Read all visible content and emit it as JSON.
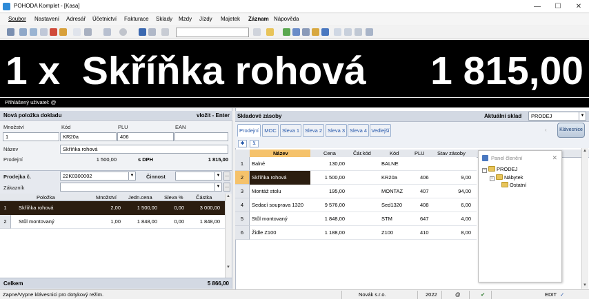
{
  "window": {
    "title": "POHODA Komplet - [Kasa]",
    "controls": {
      "minimize": "—",
      "maximize": "☐",
      "close": "✕"
    }
  },
  "menu": [
    {
      "label": "Soubor"
    },
    {
      "label": "Nastavení"
    },
    {
      "label": "Adresář"
    },
    {
      "label": "Účetnictví"
    },
    {
      "label": "Fakturace"
    },
    {
      "label": "Sklady"
    },
    {
      "label": "Mzdy"
    },
    {
      "label": "Jízdy"
    },
    {
      "label": "Majetek"
    },
    {
      "label": "Záznam"
    },
    {
      "label": "Nápověda"
    }
  ],
  "display": {
    "item": "1 x  Skříňka rohová",
    "amount": "1 815,00"
  },
  "user_bar": {
    "label": "Přihlášený uživatel: @"
  },
  "new_item": {
    "header": "Nová položka dokladu",
    "hint": "vložit - Enter",
    "labels": {
      "quantity": "Množství",
      "code": "Kód",
      "plu": "PLU",
      "ean": "EAN",
      "name": "Název",
      "price": "Prodejní",
      "vat": "s DPH"
    },
    "values": {
      "quantity": "1",
      "code": "KR20a",
      "plu": "406",
      "ean": "",
      "name": "Skříňka rohová",
      "price": "1 500,00",
      "total": "1 815,00"
    }
  },
  "receipt": {
    "label": "Prodejka č.",
    "number": "22K0300002",
    "activity_label": "Činnost",
    "customer_label": "Zákazník",
    "dots": "...",
    "columns": [
      "Položka",
      "Množství",
      "Jedn.cena",
      "Sleva %",
      "Částka"
    ],
    "rows": [
      {
        "num": "1",
        "item": "Skříňka rohová",
        "qty": "2,00",
        "unit": "1 500,00",
        "disc": "0,00",
        "amount": "3 000,00"
      },
      {
        "num": "2",
        "item": "Stůl montovaný",
        "qty": "1,00",
        "unit": "1 848,00",
        "disc": "0,00",
        "amount": "1 848,00"
      }
    ],
    "total_label": "Celkem",
    "total_value": "5 866,00"
  },
  "stock": {
    "header": "Skladové zásoby",
    "warehouse_label": "Aktuální sklad",
    "warehouse_value": "PRODEJ",
    "keyboard_button": "Klávesnice",
    "tabs": [
      "Prodejní",
      "MOC",
      "Sleva 1",
      "Sleva 2",
      "Sleva 3",
      "Sleva 4",
      "Vedlejší"
    ],
    "columns": [
      "Název",
      "Cena",
      "Čár.kód",
      "Kód",
      "PLU",
      "Stav zásoby"
    ],
    "rows": [
      {
        "num": "1",
        "name": "Balné",
        "price": "130,00",
        "barcode": "",
        "code": "BALNE",
        "plu": "",
        "stock": ""
      },
      {
        "num": "2",
        "name": "Skříňka rohová",
        "price": "1 500,00",
        "barcode": "",
        "code": "KR20a",
        "plu": "406",
        "stock": "9,00"
      },
      {
        "num": "3",
        "name": "Montáž stolu",
        "price": "195,00",
        "barcode": "",
        "code": "MONTAZ",
        "plu": "407",
        "stock": "94,00"
      },
      {
        "num": "4",
        "name": "Sedací souprava 1320",
        "price": "9 576,00",
        "barcode": "",
        "code": "Sed1320",
        "plu": "408",
        "stock": "6,00"
      },
      {
        "num": "5",
        "name": "Stůl montovaný",
        "price": "1 848,00",
        "barcode": "",
        "code": "STM",
        "plu": "647",
        "stock": "4,00"
      },
      {
        "num": "6",
        "name": "Židle Z100",
        "price": "1 188,00",
        "barcode": "",
        "code": "Z100",
        "plu": "410",
        "stock": "8,00"
      }
    ]
  },
  "tree_panel": {
    "title": "Panel členění",
    "close": "✕",
    "root": "PRODEJ",
    "child": "Nábytek",
    "grandchild": "Ostatní"
  },
  "status": {
    "message": "Zapne/Vypne klávesnici pro dotykový režim.",
    "company": "Novák s.r.o.",
    "year": "2022",
    "at": "@",
    "mode": "EDIT"
  },
  "colors": {
    "display_bg": "#000000",
    "selected_row": "#2b1d10",
    "highlight_cell": "#f5c26b",
    "panel_header": "#d3d9e3"
  }
}
